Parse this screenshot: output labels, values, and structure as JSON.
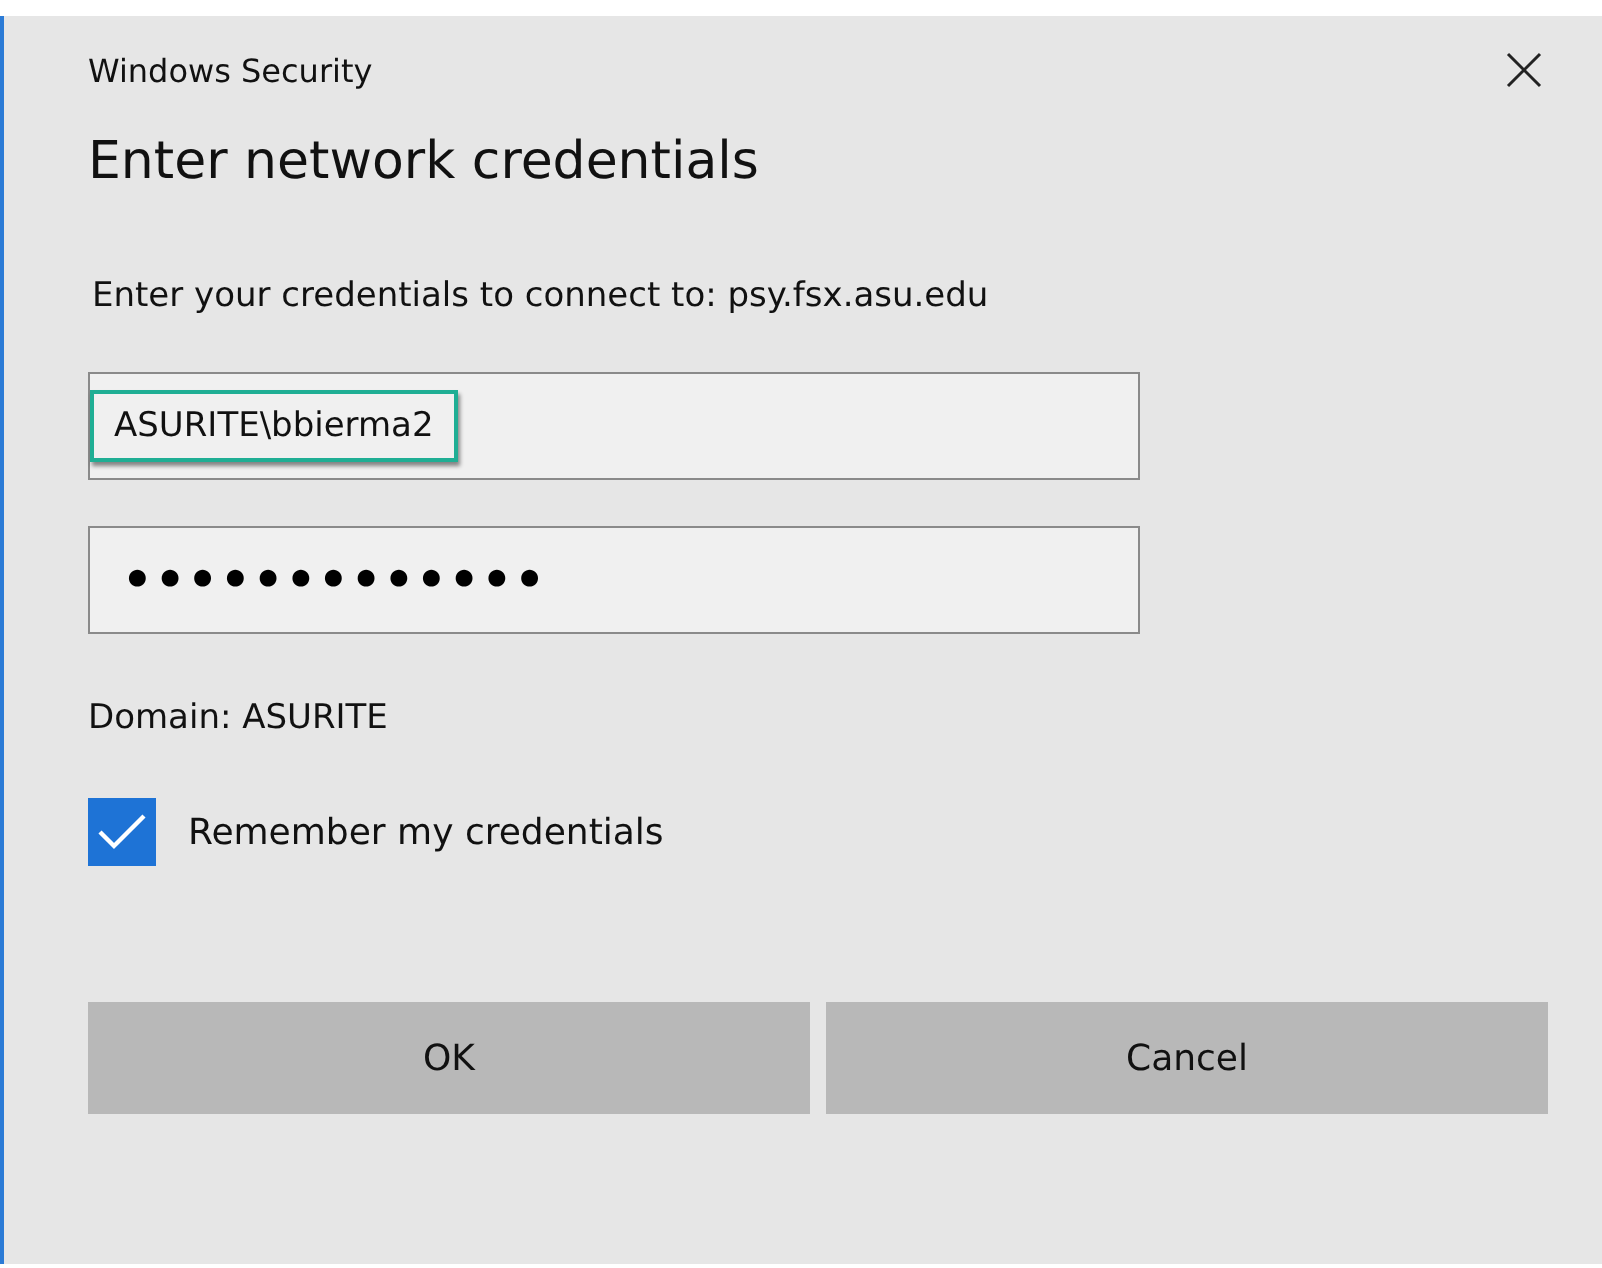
{
  "window": {
    "title": "Windows Security"
  },
  "heading": "Enter network credentials",
  "message": "Enter your credentials to connect to: psy.fsx.asu.edu",
  "username": {
    "value": "ASURITE\\bbierma2",
    "highlighted": true
  },
  "password": {
    "value": "•••••••••••••"
  },
  "domain": "Domain: ASURITE",
  "remember": {
    "label": "Remember my credentials",
    "checked": true
  },
  "buttons": [
    "OK",
    "Cancel"
  ]
}
